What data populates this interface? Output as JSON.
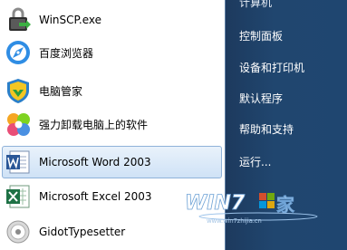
{
  "start_menu": {
    "programs": [
      {
        "label": "WinSCP.exe",
        "icon": "winscp-icon"
      },
      {
        "label": "百度浏览器",
        "icon": "baidu-browser-icon"
      },
      {
        "label": "电脑管家",
        "icon": "pc-manager-shield-icon"
      },
      {
        "label": "强力卸载电脑上的软件",
        "icon": "uninstaller-icon"
      },
      {
        "label": "Microsoft Word 2003",
        "icon": "word-icon",
        "selected": true
      },
      {
        "label": "Microsoft Excel 2003",
        "icon": "excel-icon"
      },
      {
        "label": "GidotTypesetter",
        "icon": "gidot-icon"
      }
    ],
    "right_links": [
      {
        "label": "计算机"
      },
      {
        "label": "控制面板"
      },
      {
        "label": "设备和打印机"
      },
      {
        "label": "默认程序"
      },
      {
        "label": "帮助和支持"
      },
      {
        "label": "运行..."
      }
    ]
  },
  "watermark": {
    "brand_text": "WIN7之家",
    "url": "www.win7zhijia.cn"
  },
  "colors": {
    "right_pane": "#20466f",
    "selection": "#cfe2f6",
    "word_blue": "#2b5797",
    "excel_green": "#1e7145"
  }
}
